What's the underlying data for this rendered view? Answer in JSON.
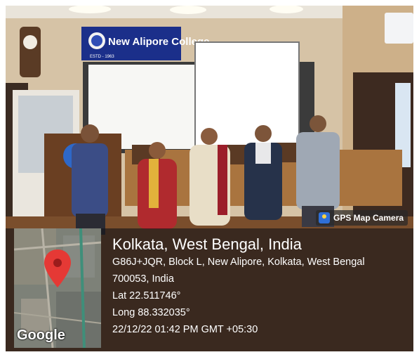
{
  "photo": {
    "banner_text": "New Alipore College",
    "banner_subtext": "ESTD - 1963"
  },
  "gps_tag": {
    "icon": "map-pin-icon",
    "label": "GPS Map Camera"
  },
  "map": {
    "marker_icon": "location-pin-icon",
    "attribution": "Google"
  },
  "info": {
    "place": "Kolkata, West Bengal, India",
    "address_line1": "G86J+JQR, Block L, New Alipore, Kolkata, West Bengal",
    "address_line2": "700053, India",
    "lat": "Lat 22.511746°",
    "long": "Long 88.332035°",
    "datetime": "22/12/22 01:42 PM GMT +05:30"
  },
  "colors": {
    "overlay": "#141419",
    "pin": "#e53935",
    "banner": "#1b2f8a"
  }
}
